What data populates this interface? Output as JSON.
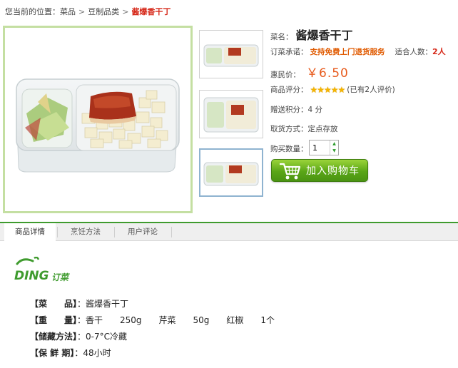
{
  "breadcrumb": {
    "prefix": "您当前的位置：",
    "items": [
      "菜品",
      "豆制品类"
    ],
    "current": "酱爆香干丁",
    "separator": ">"
  },
  "product": {
    "name_label": "菜名：",
    "name": "酱爆香干丁",
    "promise_label": "订菜承诺：",
    "promise": "支持免费上门退货服务",
    "servings_label": "适合人数：",
    "servings": "2人",
    "price_label": "惠民价：",
    "price": "￥6.50",
    "rating_label": "商品评分：",
    "rating_stars": 5,
    "rating_text": "(已有2人评价)",
    "points_label": "赠送积分：",
    "points": "4 分",
    "pickup_label": "取货方式：",
    "pickup": "定点存放",
    "qty_label": "购买数量：",
    "qty": "1",
    "cart_button": "加入购物车"
  },
  "tabs": [
    "商品详情",
    "烹饪方法",
    "用户评论"
  ],
  "active_tab": 0,
  "logo_text": "订菜",
  "logo_letters": "DING",
  "specs": [
    {
      "key": "【菜　　品】",
      "value": "：酱爆香干丁"
    },
    {
      "key": "【重　　量】",
      "value": "：香干　　250g　　芹菜　　50g　　红椒　　1个"
    },
    {
      "key": "【储藏方法】",
      "value": "：0-7°C冷藏"
    },
    {
      "key": "【保 鲜 期】",
      "value": "：48小时"
    }
  ],
  "colors": {
    "accent_green": "#3f9b2e",
    "price_orange": "#e75a1c",
    "highlight_red": "#d6291a"
  }
}
